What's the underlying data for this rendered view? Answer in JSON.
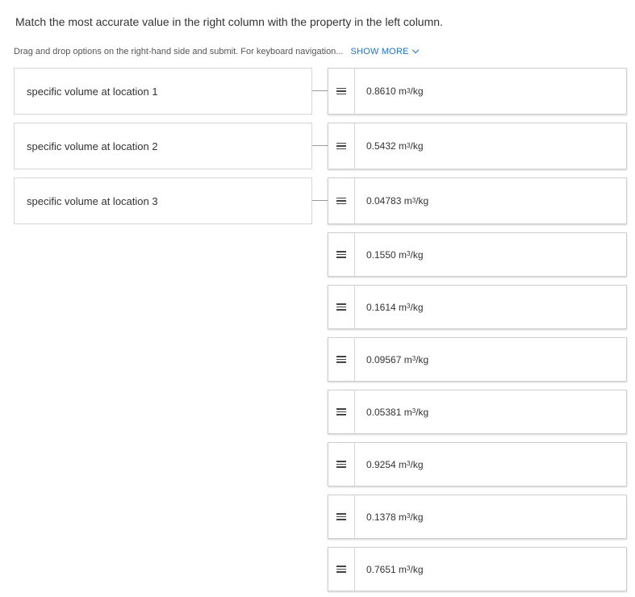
{
  "question": "Match the most accurate value in the right column with the property in the left column.",
  "instructions": {
    "text": "Drag and drop options on the right-hand side and submit. For keyboard navigation...",
    "show_more": "SHOW MORE"
  },
  "properties": [
    "specific volume at location 1",
    "specific volume at location 2",
    "specific volume at location 3"
  ],
  "options": [
    {
      "value": "0.8610",
      "unit_base": "m",
      "unit_exp": "3",
      "unit_tail": "/kg"
    },
    {
      "value": "0.5432",
      "unit_base": "m",
      "unit_exp": "3",
      "unit_tail": "/kg"
    },
    {
      "value": "0.04783",
      "unit_base": "m",
      "unit_exp": "3",
      "unit_tail": "/kg"
    },
    {
      "value": "0.1550",
      "unit_base": "m",
      "unit_exp": "3",
      "unit_tail": "/kg"
    },
    {
      "value": "0.1614",
      "unit_base": "m",
      "unit_exp": "3",
      "unit_tail": "/kg"
    },
    {
      "value": "0.09567",
      "unit_base": "m",
      "unit_exp": "3",
      "unit_tail": "/kg"
    },
    {
      "value": "0.05381",
      "unit_base": "m",
      "unit_exp": "3",
      "unit_tail": "/kg"
    },
    {
      "value": "0.9254",
      "unit_base": "m",
      "unit_exp": "3",
      "unit_tail": "/kg"
    },
    {
      "value": "0.1378",
      "unit_base": "m",
      "unit_exp": "3",
      "unit_tail": "/kg"
    },
    {
      "value": "0.7651",
      "unit_base": "m",
      "unit_exp": "3",
      "unit_tail": "/kg"
    }
  ],
  "icons": {
    "drag_handle": "drag-handle-icon",
    "show_more": "chevron-down-icon"
  },
  "colors": {
    "link": "#1a73c8",
    "border": "#d6d6d6",
    "connector": "#9a9a9a"
  }
}
